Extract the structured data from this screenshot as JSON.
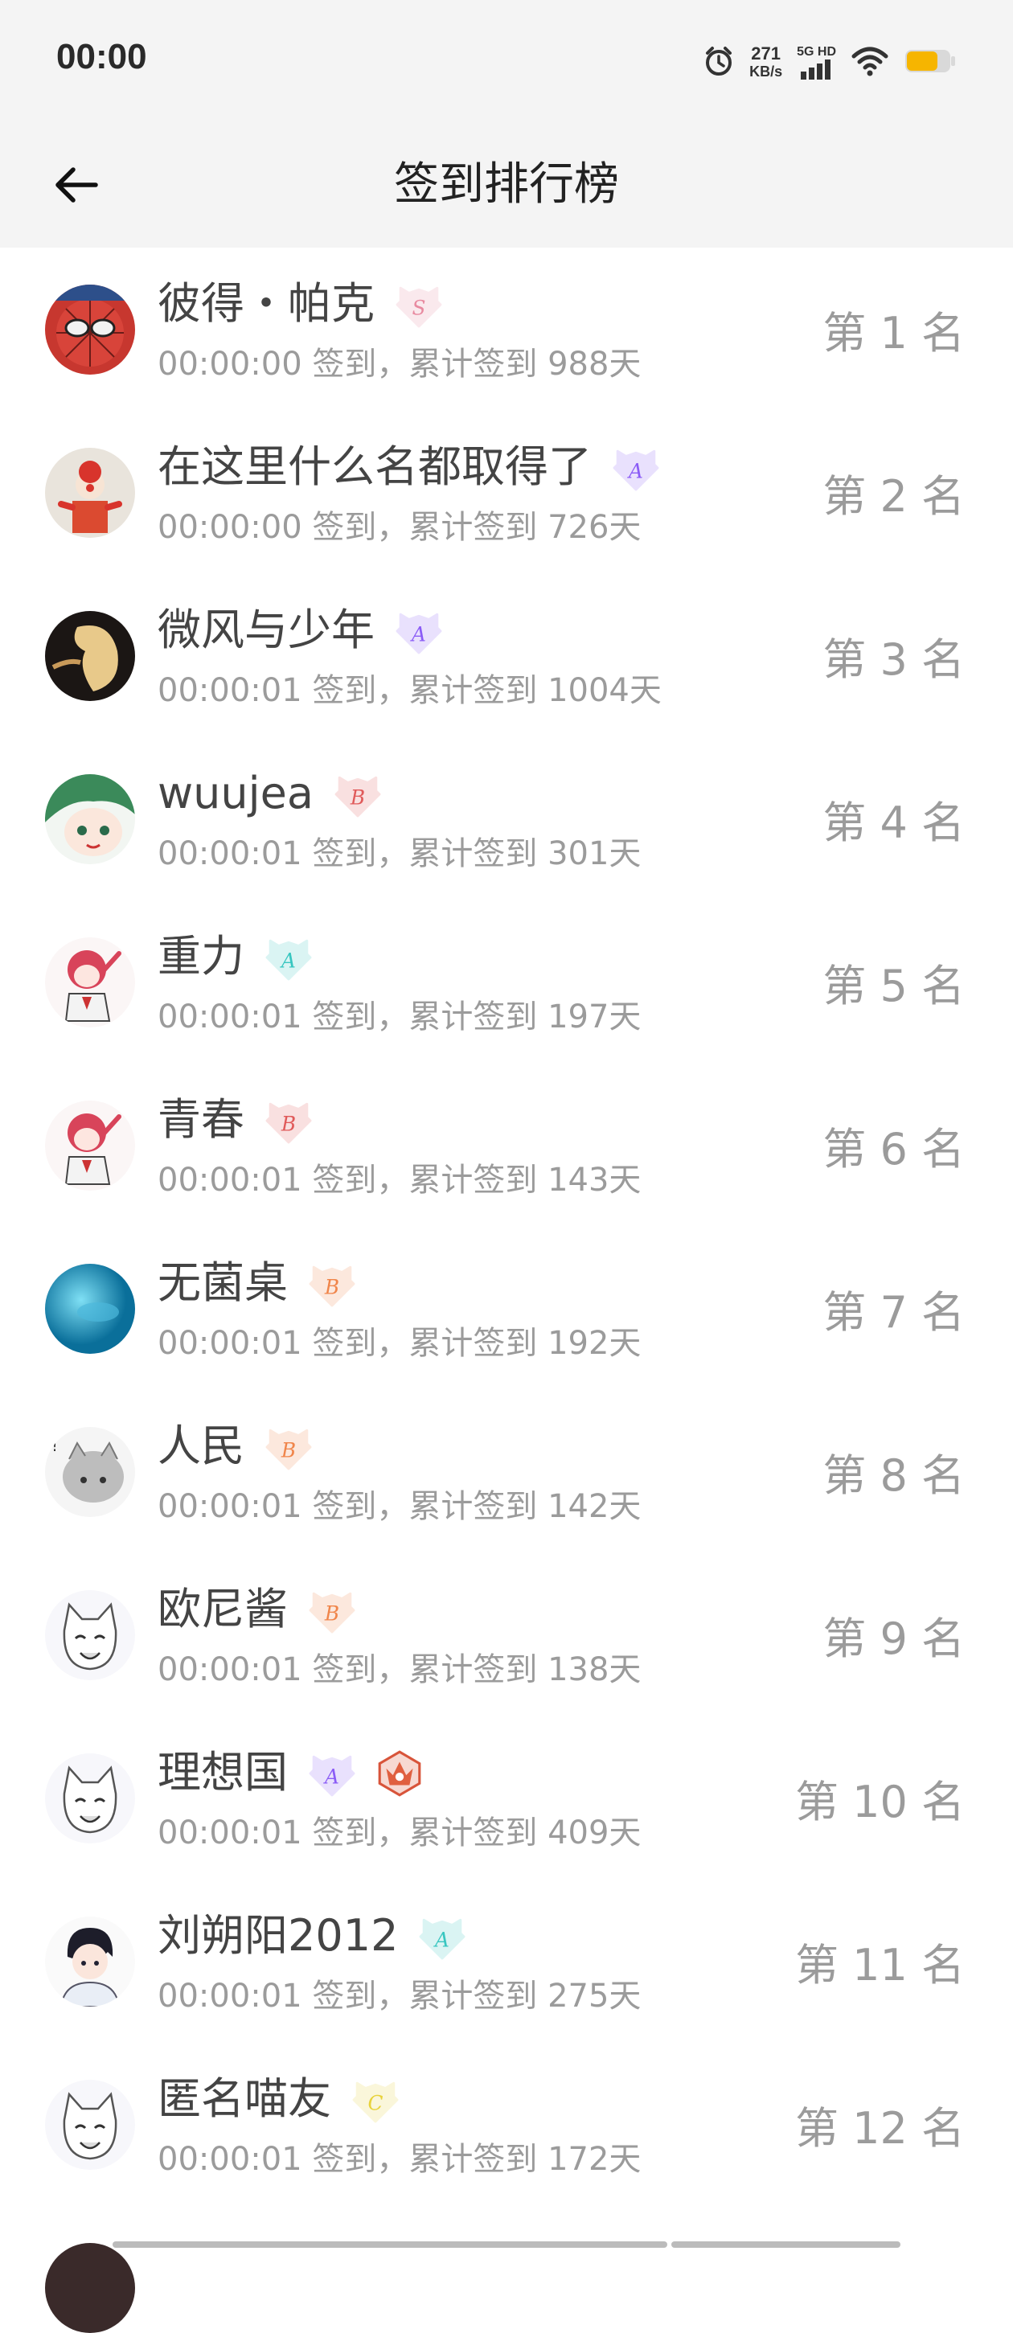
{
  "status": {
    "time": "00:00",
    "speed_value": "271",
    "speed_unit": "KB/s",
    "network": "5G HD",
    "icons": [
      "alarm-icon",
      "signal-icon",
      "wifi-icon",
      "battery-icon"
    ]
  },
  "header": {
    "title": "签到排行榜",
    "back_icon": "arrow-left-icon"
  },
  "colors": {
    "badge_s": "#e88aa0",
    "badge_a_purple": "#8b5cf6",
    "badge_b_red": "#e05a5a",
    "badge_b_orange": "#f0854a",
    "badge_a_teal": "#38c6c0",
    "badge_c_yellow": "#e8d23a",
    "text_gray": "#9b9b9b"
  },
  "users": [
    {
      "name": "彼得・帕克",
      "checkin": "00:00:00 签到，累计签到 988天",
      "rank": "第 1 名",
      "badges": [
        "S-pink"
      ]
    },
    {
      "name": "在这里什么名都取得了",
      "checkin": "00:00:00 签到，累计签到 726天",
      "rank": "第 2 名",
      "badges": [
        "A-purple"
      ]
    },
    {
      "name": "微风与少年",
      "checkin": "00:00:01 签到，累计签到 1004天",
      "rank": "第 3 名",
      "badges": [
        "A-purple"
      ]
    },
    {
      "name": "wuujea",
      "checkin": "00:00:01 签到，累计签到 301天",
      "rank": "第 4 名",
      "badges": [
        "B-red"
      ]
    },
    {
      "name": "重力",
      "checkin": "00:00:01 签到，累计签到 197天",
      "rank": "第 5 名",
      "badges": [
        "A-teal"
      ]
    },
    {
      "name": "青春",
      "checkin": "00:00:01 签到，累计签到 143天",
      "rank": "第 6 名",
      "badges": [
        "B-red"
      ]
    },
    {
      "name": "无菌桌",
      "checkin": "00:00:01 签到，累计签到 192天",
      "rank": "第 7 名",
      "badges": [
        "B-orange"
      ]
    },
    {
      "name": "人民",
      "checkin": "00:00:01 签到，累计签到 142天",
      "rank": "第 8 名",
      "badges": [
        "B-orange"
      ]
    },
    {
      "name": "欧尼酱",
      "checkin": "00:00:01 签到，累计签到 138天",
      "rank": "第 9 名",
      "badges": [
        "B-orange"
      ]
    },
    {
      "name": "理想国",
      "checkin": "00:00:01 签到，累计签到 409天",
      "rank": "第 10 名",
      "badges": [
        "A-purple",
        "crown-red"
      ]
    },
    {
      "name": "刘朔阳2012",
      "checkin": "00:00:01 签到，累计签到 275天",
      "rank": "第 11 名",
      "badges": [
        "A-teal"
      ]
    },
    {
      "name": "匿名喵友",
      "checkin": "00:00:01 签到，累计签到 172天",
      "rank": "第 12 名",
      "badges": [
        "C-yellow"
      ]
    }
  ]
}
